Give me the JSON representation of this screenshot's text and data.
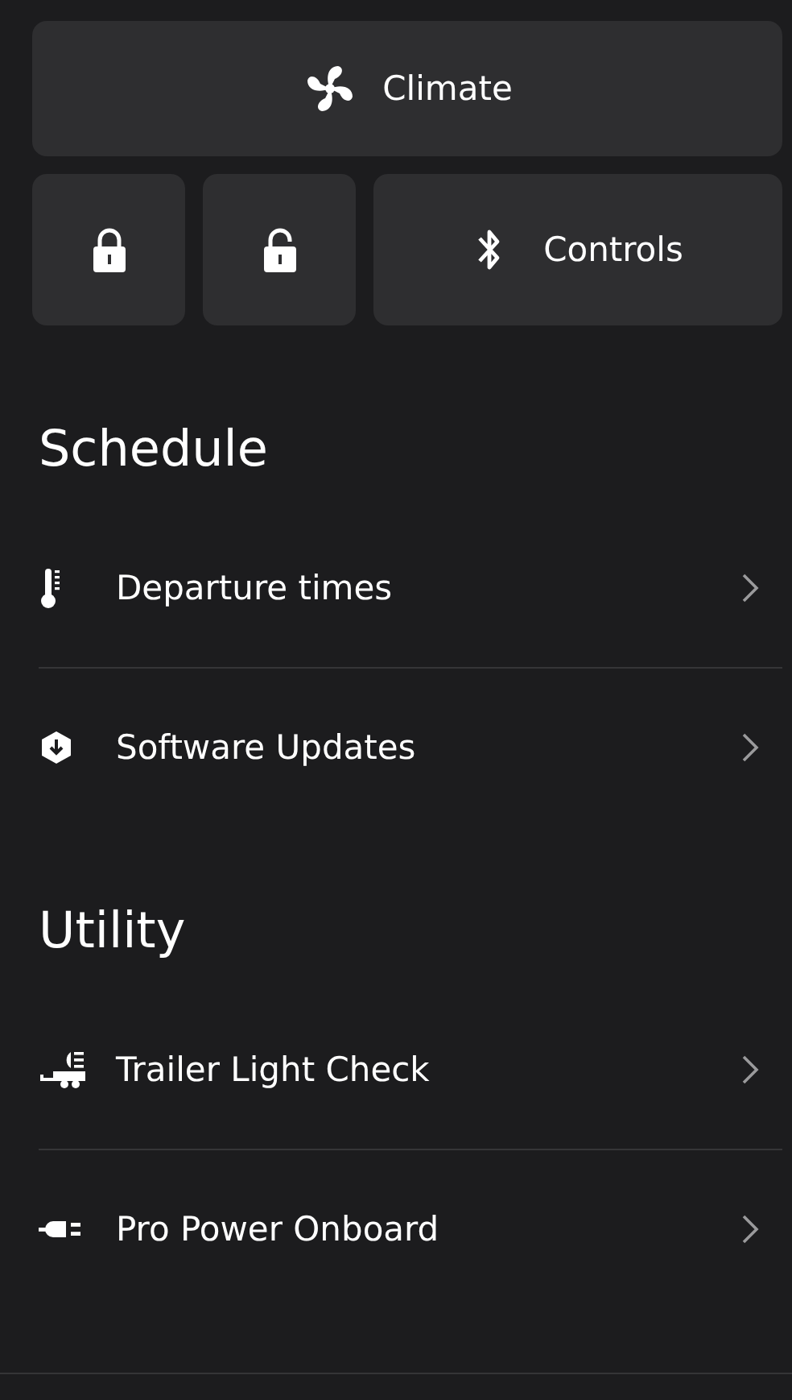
{
  "climate_button": {
    "label": "Climate"
  },
  "action_buttons": [
    {
      "kind": "lock"
    },
    {
      "kind": "unlock"
    },
    {
      "kind": "bluetooth",
      "label": "Controls"
    }
  ],
  "sections": [
    {
      "title": "Schedule",
      "items": [
        {
          "kind": "thermometer",
          "label": "Departure times"
        },
        {
          "kind": "update",
          "label": "Software Updates"
        }
      ]
    },
    {
      "title": "Utility",
      "items": [
        {
          "kind": "trailer",
          "label": "Trailer Light Check"
        },
        {
          "kind": "plug",
          "label": "Pro Power Onboard"
        }
      ]
    }
  ]
}
